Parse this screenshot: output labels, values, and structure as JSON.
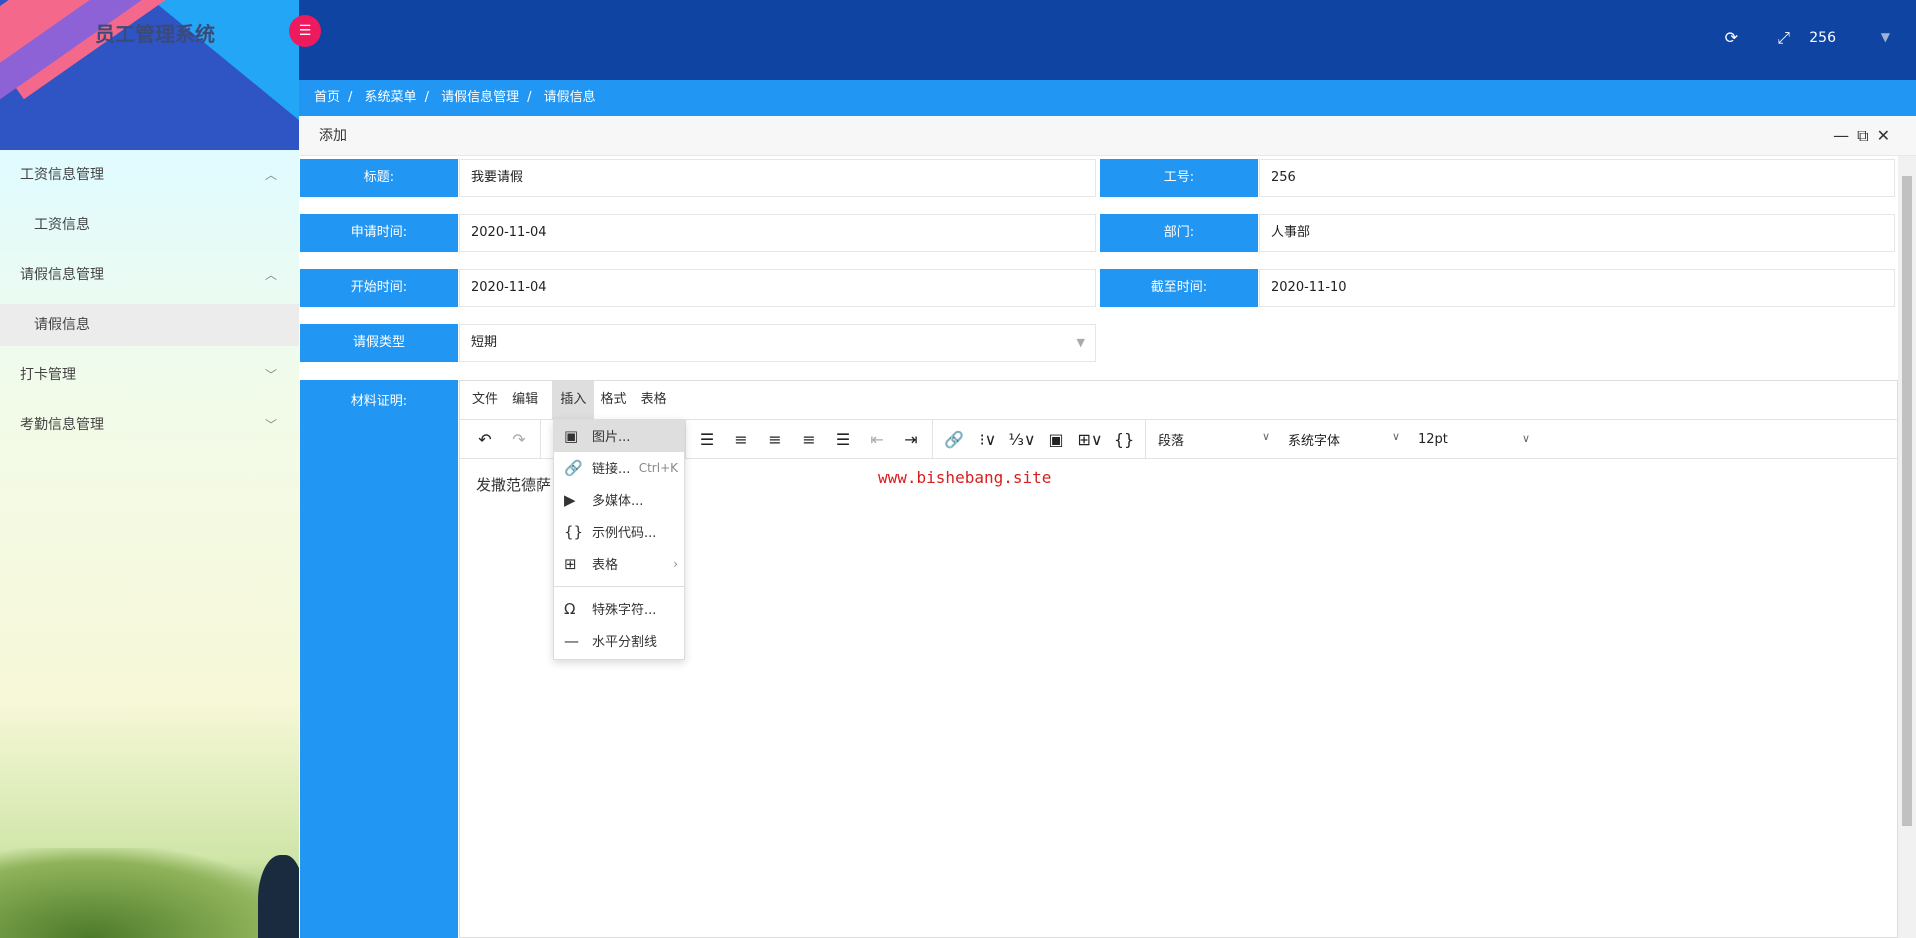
{
  "app_title": "员工管理系统",
  "header": {
    "user": "256",
    "refresh_icon": "refresh-icon",
    "fullscreen_icon": "fullscreen-icon"
  },
  "breadcrumb": [
    "首页",
    "系统菜单",
    "请假信息管理",
    "请假信息"
  ],
  "sidebar": {
    "items": [
      {
        "label": "工资信息管理",
        "type": "group"
      },
      {
        "label": "工资信息",
        "type": "sub"
      },
      {
        "label": "请假信息管理",
        "type": "group"
      },
      {
        "label": "请假信息",
        "type": "sub",
        "active": true
      },
      {
        "label": "打卡管理",
        "type": "group"
      },
      {
        "label": "考勤信息管理",
        "type": "group"
      }
    ]
  },
  "panel": {
    "title": "添加"
  },
  "form": {
    "title_label": "标题:",
    "title_value": "我要请假",
    "empno_label": "工号:",
    "empno_value": "256",
    "apply_label": "申请时间:",
    "apply_value": "2020-11-04",
    "dept_label": "部门:",
    "dept_value": "人事部",
    "start_label": "开始时间:",
    "start_value": "2020-11-04",
    "end_label": "截至时间:",
    "end_value": "2020-11-10",
    "type_label": "请假类型",
    "type_value": "短期",
    "material_label": "材料证明:"
  },
  "editor": {
    "menus": [
      "文件",
      "编辑",
      "插入",
      "格式",
      "表格"
    ],
    "block_format": "段落",
    "font_family": "系统字体",
    "font_size": "12pt",
    "content": "发撒范德萨",
    "insert_menu": [
      {
        "label": "图片...",
        "shortcut": ""
      },
      {
        "label": "链接...",
        "shortcut": "Ctrl+K"
      },
      {
        "label": "多媒体...",
        "shortcut": ""
      },
      {
        "label": "示例代码...",
        "shortcut": ""
      },
      {
        "label": "表格",
        "shortcut": ""
      },
      {
        "label": "特殊字符...",
        "shortcut": ""
      },
      {
        "label": "水平分割线",
        "shortcut": ""
      }
    ]
  },
  "watermark": "www.bishebang.site"
}
